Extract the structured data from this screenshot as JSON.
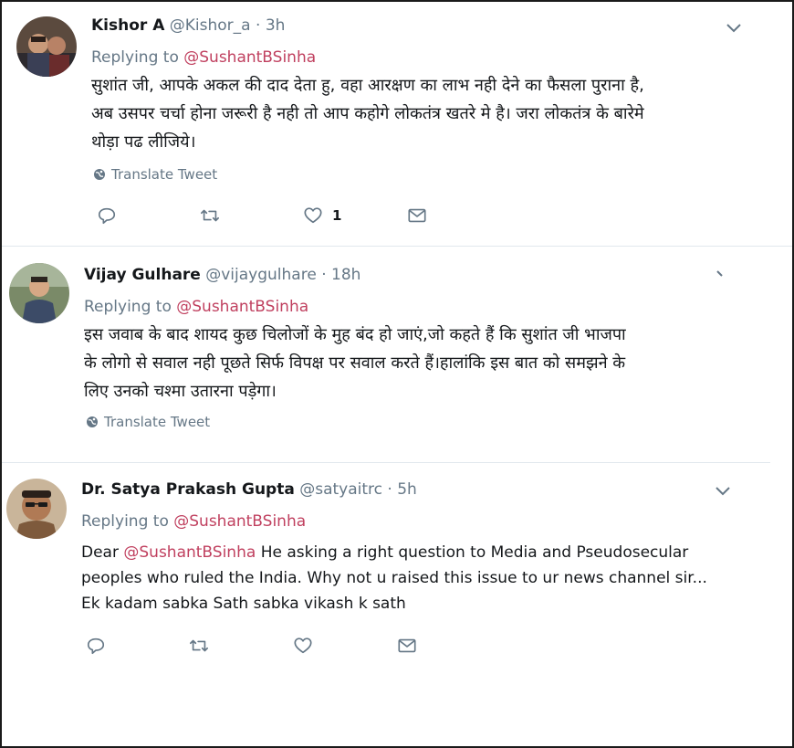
{
  "tweets": [
    {
      "name": "Kishor A",
      "handle": "@Kishor_a",
      "dot": "·",
      "time": "3h",
      "replying_prefix": "Replying to",
      "replying_to": "@SushantBSinha",
      "body_lines": [
        "सुशांत जी, आपके अकल की दाद देता हु,  वहा आरक्षण का लाभ नही देने का फैसला पुराना है,",
        "अब उसपर चर्चा होना जरूरी है नही तो आप कहोगे लोकतंत्र खतरे मे है। जरा लोकतंत्र के बारेमे",
        "थोड़ा पढ लीजिये।"
      ],
      "translate": "Translate Tweet",
      "like_count": "1"
    },
    {
      "name": "Vijay Gulhare",
      "handle": "@vijaygulhare",
      "dot": "·",
      "time": "18h",
      "replying_prefix": "Replying to",
      "replying_to": "@SushantBSinha",
      "body_lines": [
        "इस जवाब के बाद शायद कुछ चिलोजों के मुह बंद हो जाएं,जो कहते हैं कि सुशांत जी भाजपा",
        "के लोगो से सवाल नही पूछते सिर्फ विपक्ष पर सवाल करते हैं।हालांकि इस बात को समझने के",
        "लिए उनको चश्मा उतारना पड़ेगा।"
      ],
      "translate": "Translate Tweet"
    },
    {
      "name": "Dr. Satya Prakash Gupta",
      "handle": "@satyaitrc",
      "dot": "·",
      "time": "5h",
      "replying_prefix": "Replying to",
      "replying_to": "@SushantBSinha",
      "body_prefix": "Dear",
      "body_mention": "@SushantBSinha",
      "body_line1_rest": "He asking a right question to Media and Pseudosecular",
      "body_line2": "peoples who ruled the India. Why not u raised this issue to ur news channel sir...",
      "body_line3": "Ek kadam sabka Sath sabka vikash k sath"
    }
  ],
  "icons": {
    "reply": "reply-icon",
    "retweet": "retweet-icon",
    "like": "heart-icon",
    "dm": "envelope-icon",
    "menu": "chevron-down-icon",
    "globe": "globe-icon"
  },
  "colors": {
    "mention": "#c0405f",
    "muted": "#657786",
    "text": "#14171a",
    "icon": "#657786"
  }
}
